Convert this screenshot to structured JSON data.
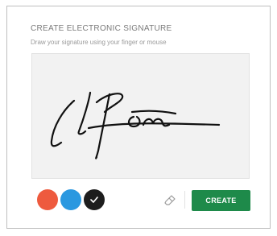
{
  "dialog": {
    "title": "CREATE ELECTRONIC SIGNATURE",
    "subtitle": "Draw your signature using your finger or mouse"
  },
  "colors": {
    "options": [
      {
        "name": "red",
        "hex": "#ee5a3e",
        "selected": false
      },
      {
        "name": "blue",
        "hex": "#2a98e0",
        "selected": false
      },
      {
        "name": "black",
        "hex": "#1d1d1d",
        "selected": true
      }
    ],
    "ink": "#111111"
  },
  "toolbar": {
    "eraser_icon": "eraser-icon",
    "create_label": "CREATE",
    "create_color": "#1e8a4a"
  }
}
